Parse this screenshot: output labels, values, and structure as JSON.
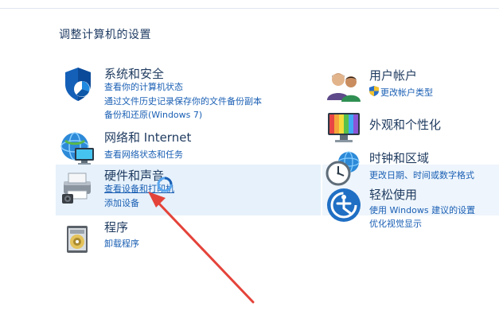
{
  "page_title": "调整计算机的设置",
  "left_categories": [
    {
      "icon": "shield-icon",
      "title": "系统和安全",
      "links": [
        "查看你的计算机状态",
        "通过文件历史记录保存你的文件备份副本",
        "备份和还原(Windows 7)"
      ]
    },
    {
      "icon": "network-globe-icon",
      "title": "网络和 Internet",
      "links": [
        "查看网络状态和任务"
      ]
    },
    {
      "icon": "printer-speaker-icon",
      "title": "硬件和声音",
      "links": [
        "查看设备和打印机",
        "添加设备"
      ]
    },
    {
      "icon": "programs-disc-icon",
      "title": "程序",
      "links": [
        "卸载程序"
      ]
    }
  ],
  "right_categories": [
    {
      "icon": "users-icon",
      "title": "用户帐户",
      "links": [
        "更改帐户类型"
      ]
    },
    {
      "icon": "appearance-monitor-icon",
      "title": "外观和个性化",
      "links": []
    },
    {
      "icon": "clock-globe-icon",
      "title": "时钟和区域",
      "links": [
        "更改日期、时间或数字格式"
      ]
    },
    {
      "icon": "ease-of-access-icon",
      "title": "轻松使用",
      "links": [
        "使用 Windows 建议的设置",
        "优化视觉显示"
      ]
    }
  ],
  "colors": {
    "link": "#1a5fb4",
    "title": "#1e3a5f",
    "highlight": "#e6f1fb",
    "annotation_arrow": "#e4433a"
  }
}
